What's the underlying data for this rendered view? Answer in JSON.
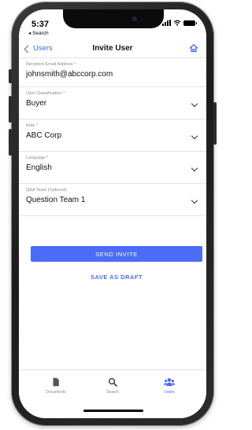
{
  "status_bar": {
    "time": "5:37",
    "back_app": "◂ Search"
  },
  "nav": {
    "back_label": "Users",
    "title": "Invite User",
    "home_icon": "home-icon"
  },
  "form": {
    "fields": [
      {
        "label": "Recipient Email Address *",
        "value": "johnsmith@abccorp.com",
        "has_dropdown": false
      },
      {
        "label": "User Classification *",
        "value": "Buyer",
        "has_dropdown": true
      },
      {
        "label": "Role *",
        "value": "ABC Corp",
        "has_dropdown": true
      },
      {
        "label": "Language *",
        "value": "English",
        "has_dropdown": true
      },
      {
        "label": "Q&A Team (Optional)",
        "value": "Question Team 1",
        "has_dropdown": true
      }
    ],
    "send_invite_label": "SEND INVITE",
    "save_draft_label": "SAVE AS DRAFT"
  },
  "tab_bar": {
    "tabs": [
      {
        "label": "Documents",
        "icon": "document-icon",
        "active": false
      },
      {
        "label": "Search",
        "icon": "search-icon",
        "active": false
      },
      {
        "label": "Users",
        "icon": "users-icon",
        "active": true
      }
    ]
  },
  "colors": {
    "accent": "#4a6cf7",
    "link": "#3d6bf5",
    "label_gray": "#8a8a8f",
    "divider": "#e3e3e6"
  }
}
